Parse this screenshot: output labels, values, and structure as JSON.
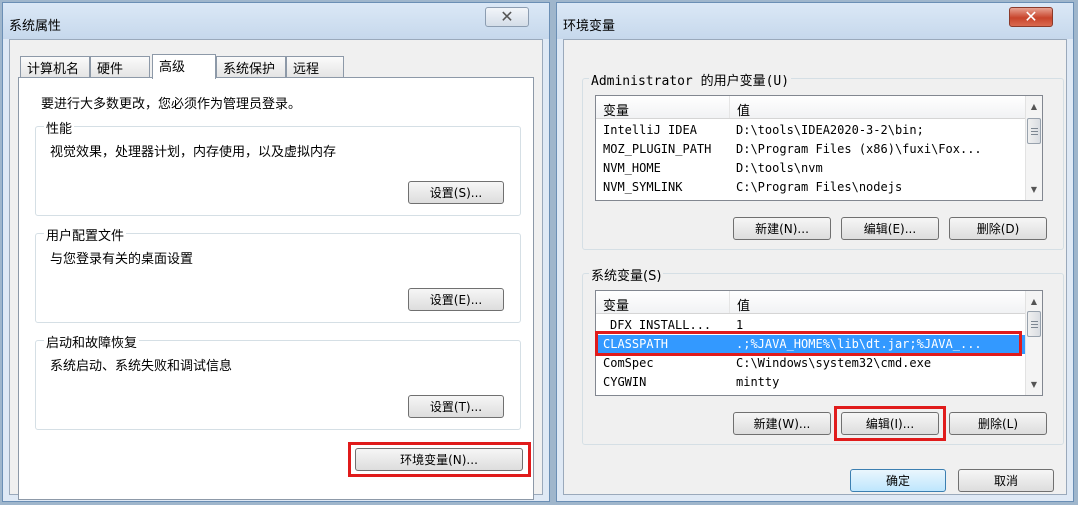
{
  "system_properties": {
    "title": "系统属性",
    "close_glyph": "✕",
    "tabs": [
      {
        "label": "计算机名",
        "active": false
      },
      {
        "label": "硬件",
        "active": false
      },
      {
        "label": "高级",
        "active": true
      },
      {
        "label": "系统保护",
        "active": false
      },
      {
        "label": "远程",
        "active": false
      }
    ],
    "admin_note": "要进行大多数更改，您必须作为管理员登录。",
    "performance": {
      "label": "性能",
      "description": "视觉效果，处理器计划，内存使用，以及虚拟内存",
      "button": "设置(S)..."
    },
    "user_profiles": {
      "label": "用户配置文件",
      "description": "与您登录有关的桌面设置",
      "button": "设置(E)..."
    },
    "startup_recovery": {
      "label": "启动和故障恢复",
      "description": "系统启动、系统失败和调试信息",
      "button": "设置(T)..."
    },
    "env_vars_button": "环境变量(N)..."
  },
  "environment_variables": {
    "title": "环境变量",
    "close_glyph": "✕",
    "user_vars": {
      "label": "Administrator 的用户变量(U)",
      "columns": [
        "变量",
        "值"
      ],
      "rows": [
        {
          "name": "IntelliJ IDEA",
          "value": "D:\\tools\\IDEA2020-3-2\\bin;"
        },
        {
          "name": "MOZ_PLUGIN_PATH",
          "value": "D:\\Program Files (x86)\\fuxi\\Fox..."
        },
        {
          "name": "NVM_HOME",
          "value": "D:\\tools\\nvm"
        },
        {
          "name": "NVM_SYMLINK",
          "value": "C:\\Program Files\\nodejs"
        }
      ],
      "buttons": {
        "new": "新建(N)...",
        "edit": "编辑(E)...",
        "delete": "删除(D)"
      }
    },
    "system_vars": {
      "label": "系统变量(S)",
      "columns": [
        "变量",
        "值"
      ],
      "rows": [
        {
          "name": "DFX_INSTALL...",
          "value": "1",
          "selected": false
        },
        {
          "name": "CLASSPATH",
          "value": ".;%JAVA_HOME%\\lib\\dt.jar;%JAVA_...",
          "selected": true
        },
        {
          "name": "ComSpec",
          "value": "C:\\Windows\\system32\\cmd.exe",
          "selected": false
        },
        {
          "name": "CYGWIN",
          "value": "mintty",
          "selected": false
        }
      ],
      "buttons": {
        "new": "新建(W)...",
        "edit": "编辑(I)...",
        "delete": "删除(L)"
      }
    },
    "ok_button": "确定",
    "cancel_button": "取消"
  },
  "colors": {
    "selection": "#3399ff",
    "highlight_box": "#e01b1b",
    "window_frame": "#dfe9f5"
  }
}
